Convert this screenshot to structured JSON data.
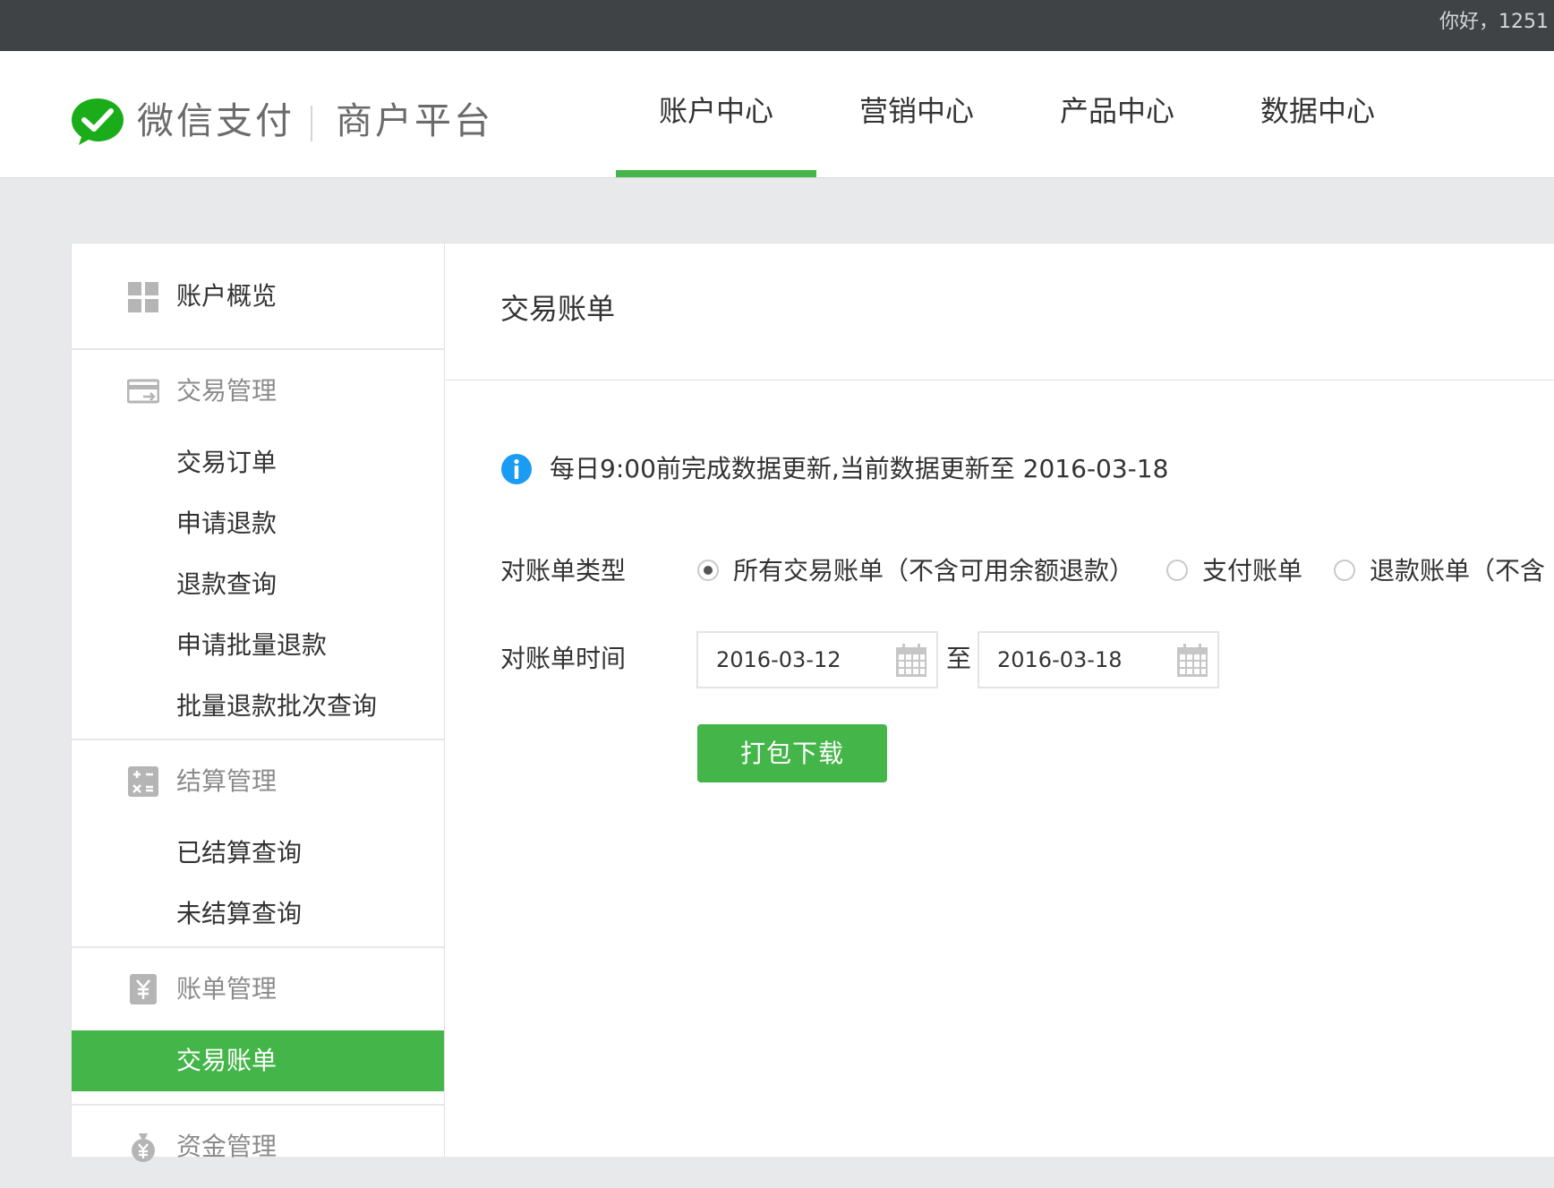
{
  "topbar": {
    "greeting": "你好，1251"
  },
  "header": {
    "brand_name": "微信支付",
    "platform_name": "商户平台",
    "nav": [
      {
        "label": "账户中心",
        "active": true
      },
      {
        "label": "营销中心",
        "active": false
      },
      {
        "label": "产品中心",
        "active": false
      },
      {
        "label": "数据中心",
        "active": false
      }
    ]
  },
  "sidebar": {
    "overview": "账户概览",
    "trade": {
      "title": "交易管理",
      "items": [
        "交易订单",
        "申请退款",
        "退款查询",
        "申请批量退款",
        "批量退款批次查询"
      ]
    },
    "settlement": {
      "title": "结算管理",
      "items": [
        "已结算查询",
        "未结算查询"
      ]
    },
    "bill": {
      "title": "账单管理",
      "items": [
        "交易账单"
      ],
      "active_item": "交易账单"
    },
    "funds": {
      "title": "资金管理"
    }
  },
  "main": {
    "title": "交易账单",
    "notice": "每日9:00前完成数据更新,当前数据更新至 2016-03-18",
    "bill_type": {
      "label": "对账单类型",
      "options": [
        {
          "label": "所有交易账单（不含可用余额退款）",
          "checked": true
        },
        {
          "label": "支付账单",
          "checked": false
        },
        {
          "label": "退款账单（不含",
          "checked": false
        }
      ]
    },
    "bill_time": {
      "label": "对账单时间",
      "start": "2016-03-12",
      "separator": "至",
      "end": "2016-03-18"
    },
    "download_button": "打包下载"
  },
  "colors": {
    "accent": "#44b549",
    "topbar": "#3f4345",
    "info_blue": "#1a9cf2"
  }
}
